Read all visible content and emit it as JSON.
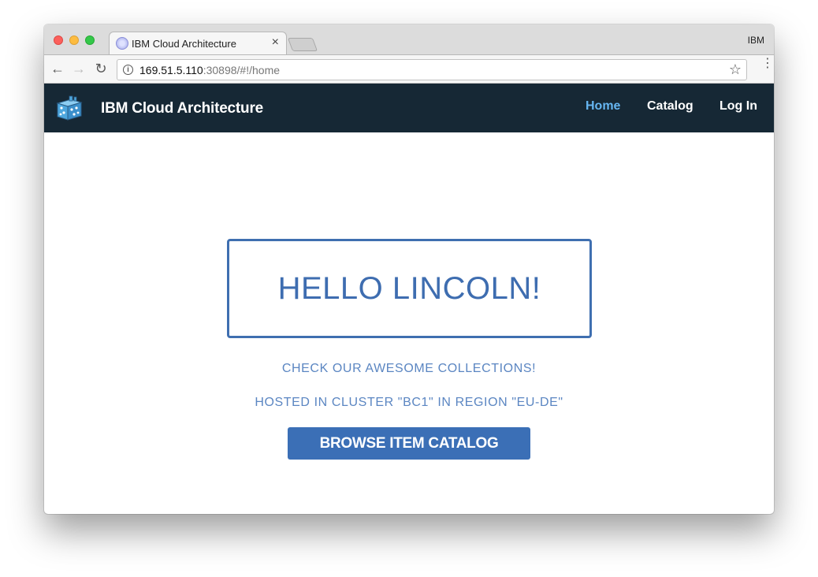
{
  "browser": {
    "tab_title": "IBM Cloud Architecture",
    "tab_close": "×",
    "profile_name": "IBM",
    "url_host": "169.51.5.110",
    "url_rest": ":30898/#!/home",
    "info_glyph": "i",
    "back_glyph": "←",
    "forward_glyph": "→",
    "reload_glyph": "↻",
    "star_glyph": "☆",
    "menu_glyph": "⋮"
  },
  "navbar": {
    "brand": "IBM Cloud Architecture",
    "links": [
      {
        "label": "Home",
        "active": true
      },
      {
        "label": "Catalog",
        "active": false
      },
      {
        "label": "Log In",
        "active": false
      }
    ],
    "active_color": "#66b6f2",
    "background": "#162835"
  },
  "main": {
    "greeting": "HELLO LINCOLN!",
    "tagline": "CHECK OUR AWESOME COLLECTIONS!",
    "cluster_info": "HOSTED IN CLUSTER \"BC1\" IN REGION \"EU-DE\"",
    "browse_button": "BROWSE ITEM CATALOG",
    "accent_color": "#3b6fb6"
  }
}
